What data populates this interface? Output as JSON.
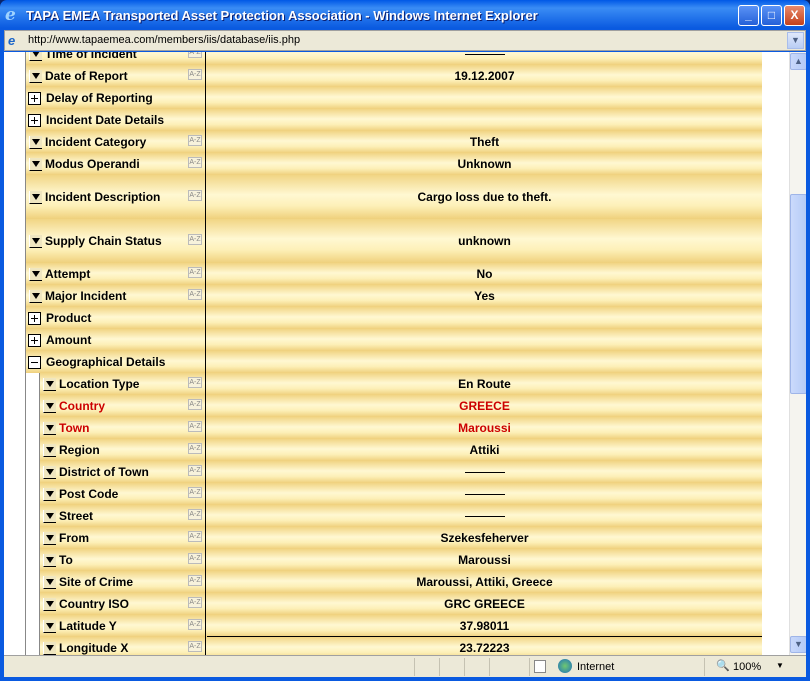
{
  "window": {
    "title": "TAPA EMEA Transported Asset Protection Association - Windows Internet Explorer",
    "url": "http://www.tapaemea.com/members/iis/database/iis.php"
  },
  "rows": [
    {
      "label": "Time of Incident",
      "value": "",
      "type": "field",
      "empty": true
    },
    {
      "label": "Date of Report",
      "value": "19.12.2007",
      "type": "field"
    },
    {
      "label": "Delay of Reporting",
      "value": "",
      "type": "plus"
    },
    {
      "label": "Incident Date Details",
      "value": "",
      "type": "plus"
    },
    {
      "label": "Incident Category",
      "value": "Theft",
      "type": "field"
    },
    {
      "label": "Modus Operandi",
      "value": "Unknown",
      "type": "field"
    },
    {
      "label": "Incident Description",
      "value": "Cargo loss due to theft.",
      "type": "field",
      "tall": true
    },
    {
      "label": "Supply Chain Status",
      "value": "unknown",
      "type": "field",
      "tall": true
    },
    {
      "label": "Attempt",
      "value": "No",
      "type": "field"
    },
    {
      "label": "Major Incident",
      "value": "Yes",
      "type": "field"
    },
    {
      "label": "Product",
      "value": "",
      "type": "plus"
    },
    {
      "label": "Amount",
      "value": "",
      "type": "plus"
    },
    {
      "label": "Geographical Details",
      "value": "",
      "type": "minus"
    },
    {
      "label": "Location Type",
      "value": "En Route",
      "type": "field",
      "sub": true
    },
    {
      "label": "Country",
      "value": "GREECE",
      "type": "field",
      "sub": true,
      "highlight": true
    },
    {
      "label": "Town",
      "value": "Maroussi",
      "type": "field",
      "sub": true,
      "highlight": true
    },
    {
      "label": "Region",
      "value": "Attiki",
      "type": "field",
      "sub": true
    },
    {
      "label": "District of Town",
      "value": "",
      "type": "field",
      "sub": true,
      "empty": true
    },
    {
      "label": "Post Code",
      "value": "",
      "type": "field",
      "sub": true,
      "empty": true
    },
    {
      "label": "Street",
      "value": "",
      "type": "field",
      "sub": true,
      "empty": true
    },
    {
      "label": "From",
      "value": "Szekesfeherver",
      "type": "field",
      "sub": true
    },
    {
      "label": "To",
      "value": "Maroussi",
      "type": "field",
      "sub": true
    },
    {
      "label": "Site of Crime",
      "value": "Maroussi, Attiki, Greece",
      "type": "field",
      "sub": true
    },
    {
      "label": "Country ISO",
      "value": "GRC GREECE",
      "type": "field",
      "sub": true
    },
    {
      "label": "Latitude Y",
      "value": "37.98011",
      "type": "field",
      "sub": true
    },
    {
      "label": "Longitude X",
      "value": "23.72223",
      "type": "field",
      "sub": true
    }
  ],
  "sort_icon_text": "A-Z",
  "status": {
    "zone": "Internet",
    "zoom": "100%"
  },
  "colors": {
    "highlight": "#cc0000",
    "row": "#fff8d2"
  }
}
